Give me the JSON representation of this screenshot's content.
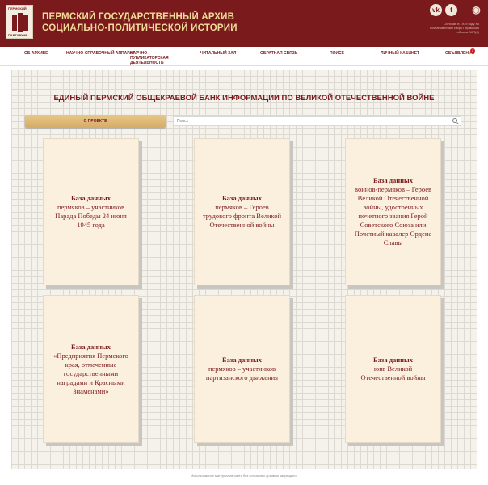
{
  "header": {
    "logo_top": "ПЕРМСКИЙ",
    "logo_bottom": "ПАРТАРХИВ",
    "title_line1": "ПЕРМСКИЙ ГОСУДАРСТВЕННЫЙ АРХИВ",
    "title_line2": "СОЦИАЛЬНО-ПОЛИТИЧЕСКОЙ ИСТОРИИ",
    "vk_icon_glyph": "vk",
    "fb_icon_glyph": "f",
    "eye_icon_glyph": "◉",
    "note": "Основан в 1939 году по постановлению Бюро Пермского обкома ВКП(б)"
  },
  "nav": {
    "items": [
      {
        "label": "ОБ АРХИВЕ"
      },
      {
        "label": "НАУЧНО-СПРАВОЧНЫЙ АППАРАТ"
      },
      {
        "label": "НАУЧНО-ПУБЛИКАТОРСКАЯ ДЕЯТЕЛЬНОСТЬ"
      },
      {
        "label": "ЧИТАЛЬНЫЙ ЗАЛ"
      },
      {
        "label": "ОБРАТНАЯ СВЯЗЬ"
      },
      {
        "label": "ПОИСК"
      },
      {
        "label": "ЛИЧНЫЙ КАБИНЕТ"
      },
      {
        "label": "ОБЪЯВЛЕНИЯ"
      }
    ],
    "badge": "1"
  },
  "main": {
    "title": "ЕДИНЫЙ ПЕРМСКИЙ ОБЩЕКРАЕВОЙ БАНК ИНФОРМАЦИИ ПО ВЕЛИКОЙ ОТЕЧЕСТВЕННОЙ ВОЙНЕ",
    "about_button": "О ПРОЕКТЕ",
    "search_placeholder": "Поиск"
  },
  "cards": [
    {
      "head": "База данных",
      "body": "пермяков – участников Парада Победы 24 июня 1945 года"
    },
    {
      "head": "База данных",
      "body": "пермяков – Героев трудового фронта Великой Отечественной войны"
    },
    {
      "head": "База данных",
      "body": "воинов-пермяков – Героев Великой Отечественной войны, удостоенных почетного звания Герой Советского Союза или Почетный кавалер Ордена Славы"
    },
    {
      "head": "База данных",
      "body": "«Предприятия Пермского края, отмеченные государственными наградами и Красными Знаменами»"
    },
    {
      "head": "База данных",
      "body": "пермяков – участников партизанского движения"
    },
    {
      "head": "База данных",
      "body": "юнг Великой Отечественной войны"
    }
  ],
  "footer": {
    "text": "Использование материалов сайта без согласия с архивом запрещено."
  }
}
